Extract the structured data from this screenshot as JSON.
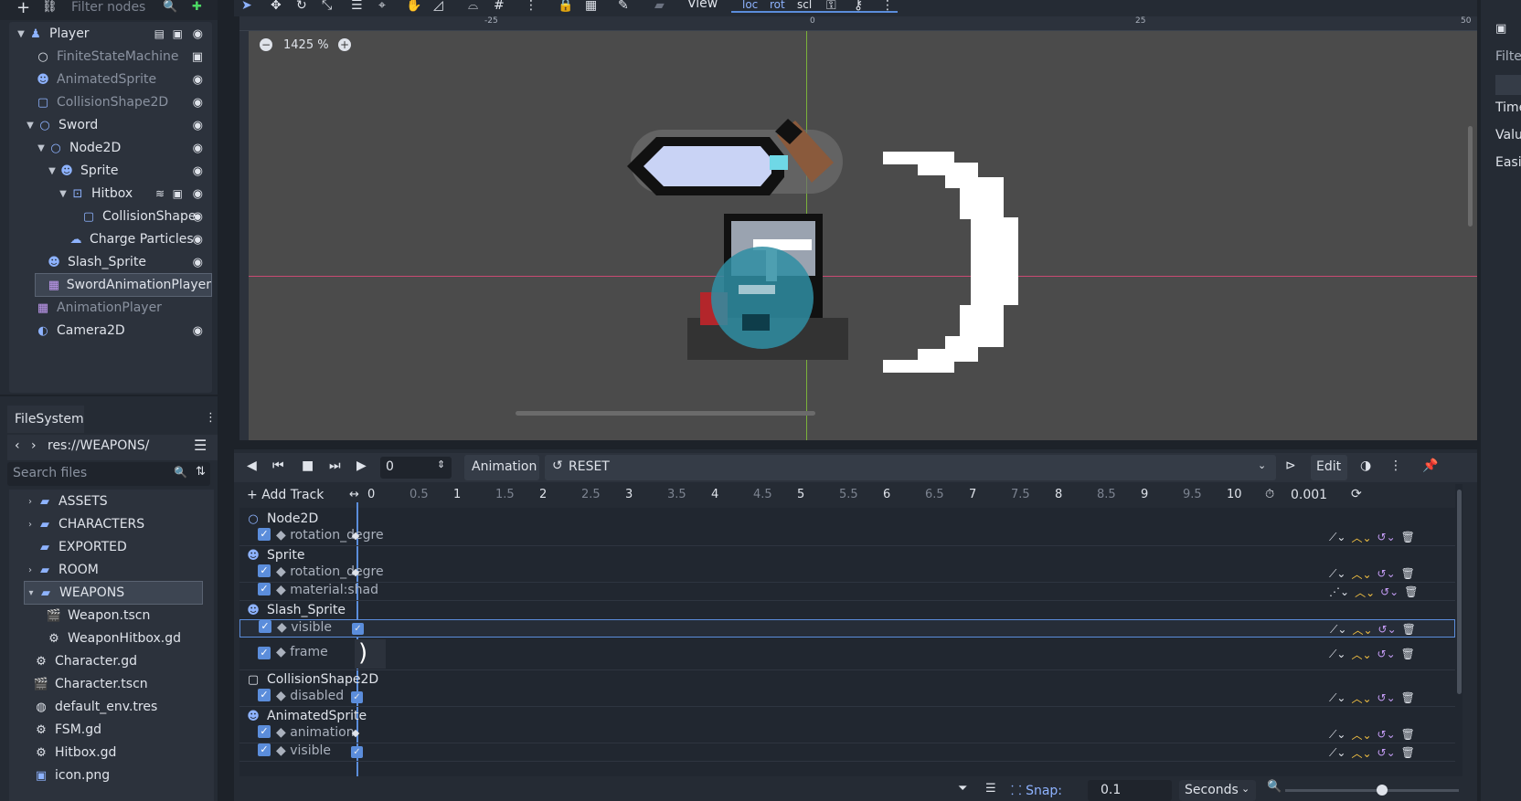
{
  "scene_dock": {
    "filter_placeholder": "Filter nodes",
    "nodes": [
      {
        "label": "Player",
        "dim": false
      },
      {
        "label": "FiniteStateMachine",
        "dim": true
      },
      {
        "label": "AnimatedSprite",
        "dim": true
      },
      {
        "label": "CollisionShape2D",
        "dim": true
      },
      {
        "label": "Sword",
        "dim": false
      },
      {
        "label": "Node2D",
        "dim": false
      },
      {
        "label": "Sprite",
        "dim": false
      },
      {
        "label": "Hitbox",
        "dim": false
      },
      {
        "label": "CollisionShape",
        "dim": false
      },
      {
        "label": "Charge Particles",
        "dim": false
      },
      {
        "label": "Slash_Sprite",
        "dim": false
      },
      {
        "label": "SwordAnimationPlayer",
        "dim": false,
        "selected": true
      },
      {
        "label": "AnimationPlayer",
        "dim": true
      },
      {
        "label": "Camera2D",
        "dim": false
      }
    ]
  },
  "filesystem": {
    "tab_label": "FileSystem",
    "path": "res://WEAPONS/",
    "search_placeholder": "Search files",
    "items": [
      {
        "label": "ASSETS",
        "type": "folder"
      },
      {
        "label": "CHARACTERS",
        "type": "folder"
      },
      {
        "label": "EXPORTED",
        "type": "folder"
      },
      {
        "label": "ROOM",
        "type": "folder"
      },
      {
        "label": "WEAPONS",
        "type": "folder",
        "selected": true
      },
      {
        "label": "Weapon.tscn",
        "type": "scene"
      },
      {
        "label": "WeaponHitbox.gd",
        "type": "script"
      },
      {
        "label": "Character.gd",
        "type": "script"
      },
      {
        "label": "Character.tscn",
        "type": "scene"
      },
      {
        "label": "default_env.tres",
        "type": "resource"
      },
      {
        "label": "FSM.gd",
        "type": "script"
      },
      {
        "label": "Hitbox.gd",
        "type": "script"
      },
      {
        "label": "icon.png",
        "type": "image"
      }
    ]
  },
  "viewport": {
    "view_menu": "View",
    "zoom": "1425 %",
    "ruler_ticks": [
      "-25",
      "0",
      "25",
      "50"
    ]
  },
  "animation": {
    "time_value": "0",
    "animation_menu": "Animation",
    "current_animation": "RESET",
    "edit_label": "Edit",
    "add_track_label": "Add Track",
    "timeline_ticks": [
      "0",
      "0.5",
      "1",
      "1.5",
      "2",
      "2.5",
      "3",
      "3.5",
      "4",
      "4.5",
      "5",
      "5.5",
      "6",
      "6.5",
      "7",
      "7.5",
      "8",
      "8.5",
      "9",
      "9.5",
      "10"
    ],
    "step_value": "0.001",
    "tracks": [
      {
        "group": "Node2D"
      },
      {
        "label": "rotation_degre",
        "key": "diamond"
      },
      {
        "group": "Sprite"
      },
      {
        "label": "rotation_degre",
        "key": "diamond"
      },
      {
        "label": "material:shad",
        "key": "none"
      },
      {
        "group": "Slash_Sprite"
      },
      {
        "label": "visible",
        "key": "check",
        "selected": true
      },
      {
        "label": "frame",
        "key": "frame"
      },
      {
        "group": "CollisionShape2D"
      },
      {
        "label": "disabled",
        "key": "check"
      },
      {
        "group": "AnimatedSprite"
      },
      {
        "label": "animation",
        "key": "diamond"
      },
      {
        "label": "visible",
        "key": "check"
      }
    ],
    "snap_label": "Snap:",
    "snap_value": "0.1",
    "snap_unit": "Seconds"
  },
  "right_dock": {
    "filter_label": "Filte",
    "time_label": "Time",
    "value_label": "Valu",
    "easing_label": "Easin"
  }
}
